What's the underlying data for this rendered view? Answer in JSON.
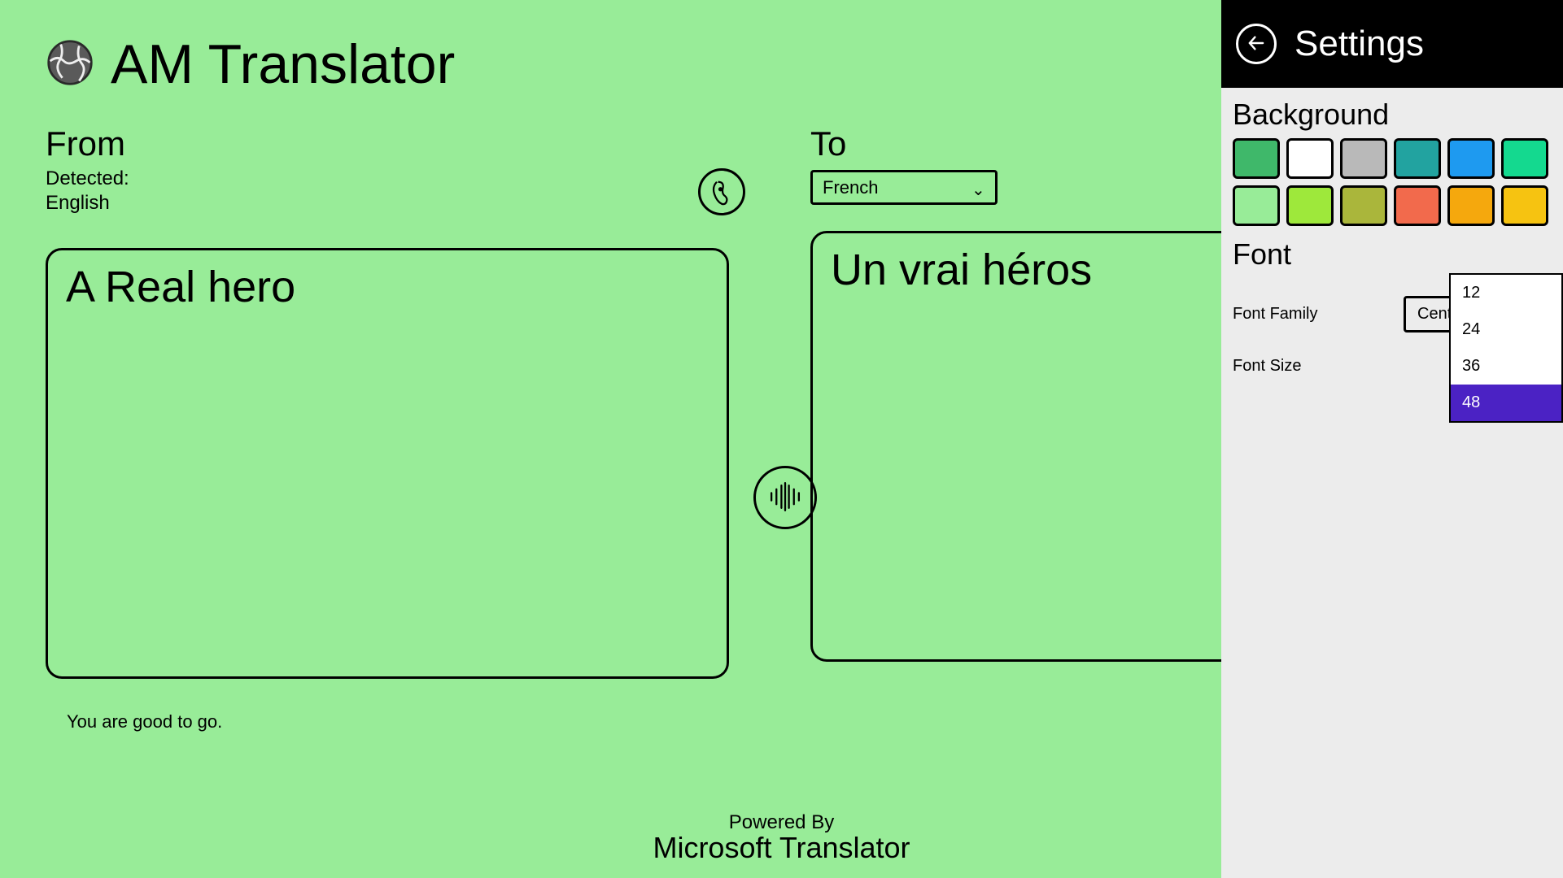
{
  "app": {
    "title": "AM Translator"
  },
  "from": {
    "label": "From",
    "detected_label": "Detected:",
    "detected_lang": "English",
    "text": "A Real hero"
  },
  "to": {
    "label": "To",
    "selected_lang": "French",
    "text": "Un vrai héros"
  },
  "status": "You are good to go.",
  "footer": {
    "line1": "Powered By",
    "line2": "Microsoft Translator"
  },
  "settings": {
    "title": "Settings",
    "background_label": "Background",
    "font_label": "Font",
    "font_family_label": "Font Family",
    "font_family_value": "Century",
    "font_size_label": "Font Size",
    "swatches": [
      "#3fb86a",
      "#ffffff",
      "#b9b9b9",
      "#22a3a0",
      "#1e9af0",
      "#14d98f",
      "#98ec98",
      "#9ee83b",
      "#aab63b",
      "#f26a4c",
      "#f5a80d",
      "#f6c311"
    ],
    "font_sizes": [
      "12",
      "24",
      "36",
      "48"
    ],
    "font_size_selected": "48"
  }
}
